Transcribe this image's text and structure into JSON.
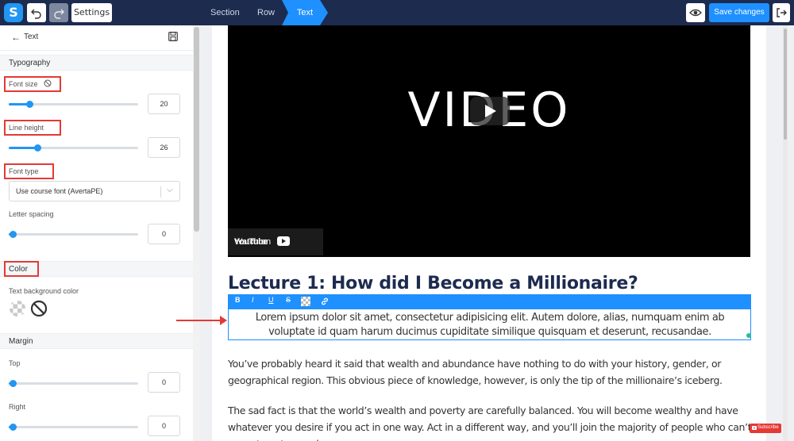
{
  "topbar": {
    "logo": "S",
    "undo_icon": "undo-icon",
    "redo_icon": "redo-icon",
    "settings_label": "Settings",
    "breadcrumbs": [
      "Section",
      "Row",
      "Text"
    ],
    "preview_icon": "eye-icon",
    "save_label": "Save changes",
    "exit_icon": "exit-icon"
  },
  "panel": {
    "title": "Text",
    "typography": {
      "heading": "Typography",
      "font_size": {
        "label": "Font size",
        "value": "20",
        "fraction": 0.16
      },
      "line_height": {
        "label": "Line height",
        "value": "26",
        "fraction": 0.22
      },
      "font_type": {
        "label": "Font type",
        "value": "Use course font (AvertaPE)"
      },
      "letter_spacing": {
        "label": "Letter spacing",
        "value": "0",
        "fraction": 0.03
      }
    },
    "color": {
      "heading": "Color",
      "bg_label": "Text background color"
    },
    "margin": {
      "heading": "Margin",
      "top": {
        "label": "Top",
        "value": "0",
        "fraction": 0.03
      },
      "right": {
        "label": "Right",
        "value": "0",
        "fraction": 0.03
      }
    }
  },
  "video": {
    "placeholder": "VIDEO",
    "watch_on": "Watch on",
    "brand": "YouTube"
  },
  "lecture": {
    "title": "Lecture 1: How did I Become a Millionaire?",
    "toolbar": [
      "B",
      "I",
      "U",
      "S"
    ],
    "selected_text": "Lorem ipsum dolor sit amet, consectetur adipisicing elit. Autem dolore, alias, numquam enim ab voluptate id quam harum ducimus cupiditate similique quisquam et deserunt, recusandae.",
    "paragraphs": [
      "You’ve probably heard it said that wealth and abundance have nothing to do with your history, gender, or geographical region. This obvious piece of knowledge, however, is only the tip of the millionaire’s iceberg.",
      "The sad fact is that the world’s wealth and poverty are carefully balanced. You will become wealthy and have whatever you desire if you act in one way. Act in a different way, and you’ll join the majority of people who can’t seem to get enough."
    ]
  },
  "badge": {
    "label": "Subscribe"
  },
  "colors": {
    "accent": "#1e90ff",
    "topbar": "#1d2b4f",
    "highlight": "#e53935"
  }
}
